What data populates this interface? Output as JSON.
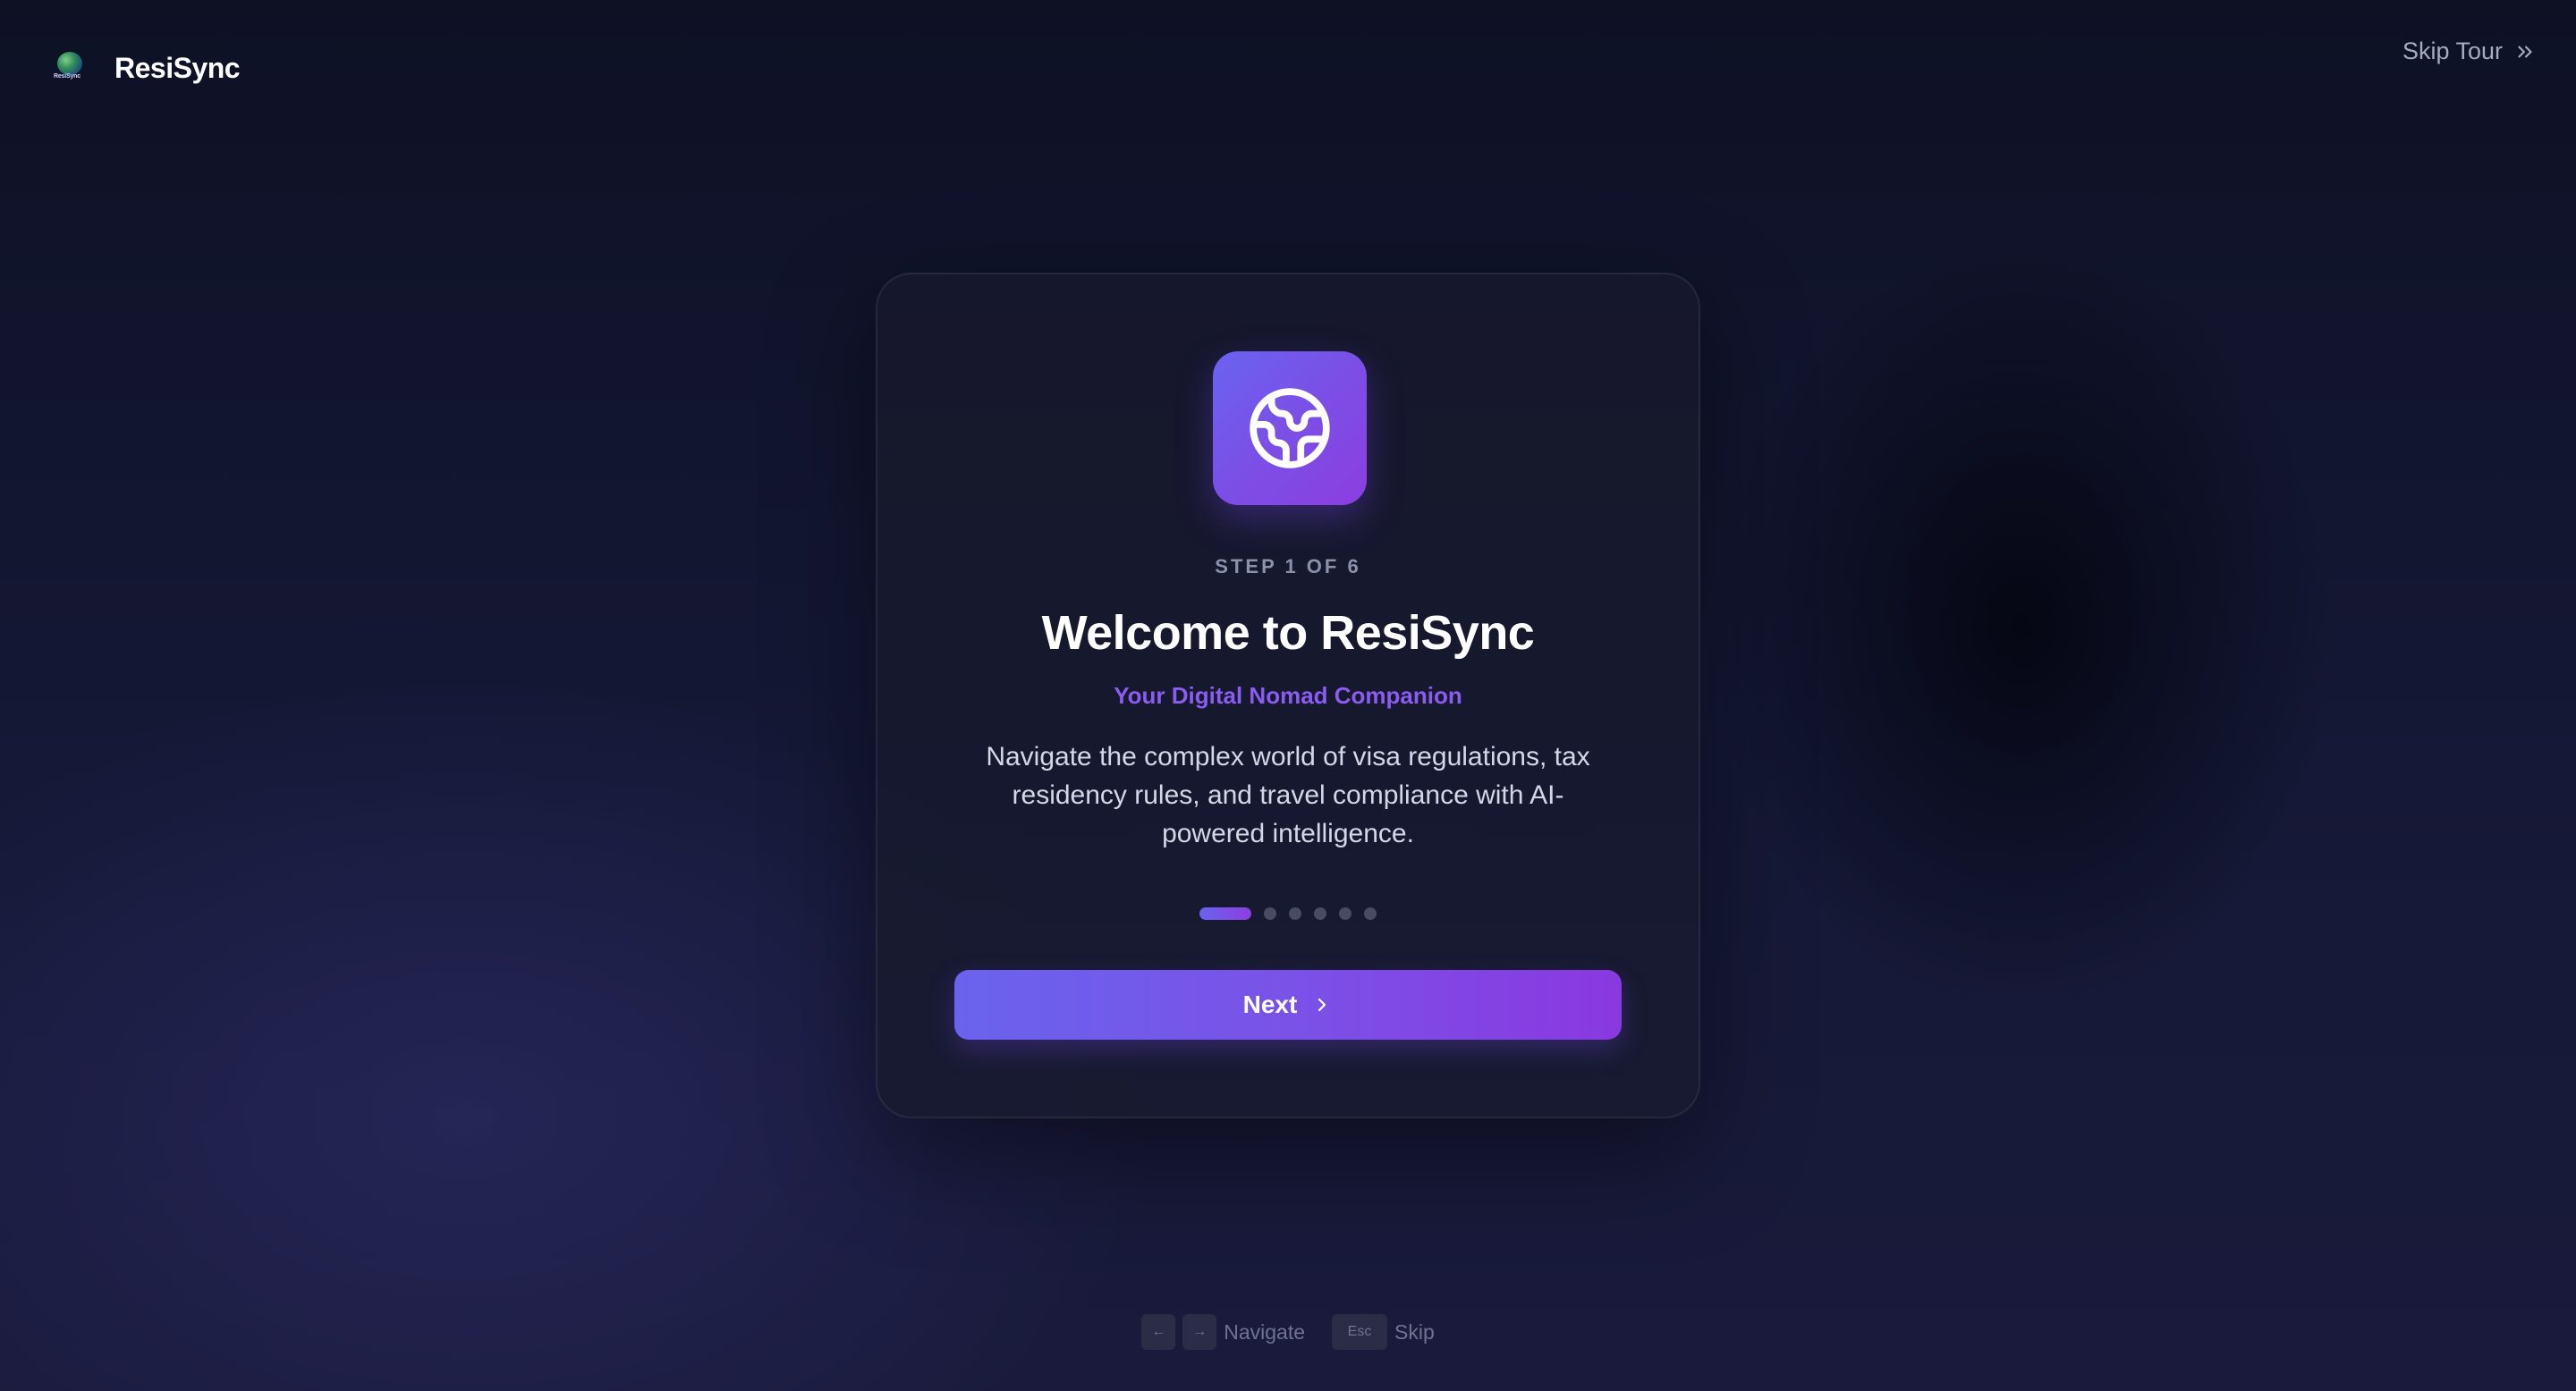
{
  "app": {
    "brand_name": "ResiSync",
    "logo_small_text": "ResiSync"
  },
  "header": {
    "skip_tour_label": "Skip Tour"
  },
  "onboarding": {
    "icon": "globe-icon",
    "step_label": "STEP 1 OF 6",
    "title": "Welcome to ResiSync",
    "subtitle": "Your Digital Nomad Companion",
    "description": "Navigate the complex world of visa regulations, tax residency rules, and travel compliance with AI-powered intelligence.",
    "progress": {
      "current_step": 1,
      "total_steps": 6
    },
    "next_button_label": "Next"
  },
  "keyboard_hints": {
    "prev_key": "←",
    "next_key": "→",
    "navigate_label": "Navigate",
    "esc_key": "Esc",
    "skip_label": "Skip"
  },
  "colors": {
    "accent_start": "#6a63f0",
    "accent_end": "#8c3ee0",
    "subtitle": "#8a5cf0",
    "background": "#12152e"
  }
}
